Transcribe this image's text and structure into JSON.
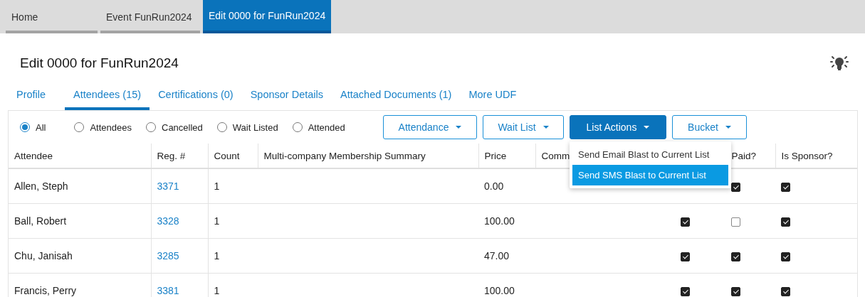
{
  "nav_tabs": [
    {
      "label": "Home",
      "selected": false
    },
    {
      "label": "Event FunRun2024",
      "selected": false
    },
    {
      "label": "Edit 0000 for FunRun2024",
      "selected": true
    }
  ],
  "title": "Edit 0000 for FunRun2024",
  "sub_tabs": [
    {
      "label": "Profile",
      "selected": false
    },
    {
      "label": "Attendees (15)",
      "selected": true
    },
    {
      "label": "Certifications (0)",
      "selected": false
    },
    {
      "label": "Sponsor Details",
      "selected": false
    },
    {
      "label": "Attached Documents (1)",
      "selected": false
    },
    {
      "label": "More UDF",
      "selected": false
    }
  ],
  "filters": [
    {
      "label": "All",
      "selected": true
    },
    {
      "label": "Attendees",
      "selected": false
    },
    {
      "label": "Cancelled",
      "selected": false
    },
    {
      "label": "Wait Listed",
      "selected": false
    },
    {
      "label": "Attended",
      "selected": false
    }
  ],
  "action_buttons": [
    {
      "label": "Attendance",
      "expanded": false
    },
    {
      "label": "Wait List",
      "expanded": false
    },
    {
      "label": "List Actions",
      "expanded": true,
      "menu": [
        {
          "label": "Send Email Blast to Current List",
          "selected": false
        },
        {
          "label": "Send SMS Blast to Current List",
          "selected": true
        }
      ]
    },
    {
      "label": "Bucket",
      "expanded": false
    }
  ],
  "table": {
    "columns": [
      "Attendee",
      "Reg. #",
      "Count",
      "Multi-company Membership Summary",
      "Price",
      "Comm",
      "",
      "Paid?",
      "Is Sponsor?"
    ],
    "rows": [
      {
        "attendee": "Allen, Steph",
        "reg": "3371",
        "count": "1",
        "price": "0.00",
        "paid": true,
        "is_sponsor": true
      },
      {
        "attendee": "Ball, Robert",
        "reg": "3328",
        "count": "1",
        "price": "100.00",
        "column_7": true,
        "paid": false,
        "is_sponsor": true
      },
      {
        "attendee": "Chu, Janisah",
        "reg": "3285",
        "count": "1",
        "price": "47.00",
        "column_7": true,
        "paid": true,
        "is_sponsor": true
      },
      {
        "attendee": "Francis, Perry",
        "reg": "3381",
        "count": "1",
        "price": "100.00",
        "column_7": true,
        "paid": true,
        "is_sponsor": true
      }
    ]
  }
}
